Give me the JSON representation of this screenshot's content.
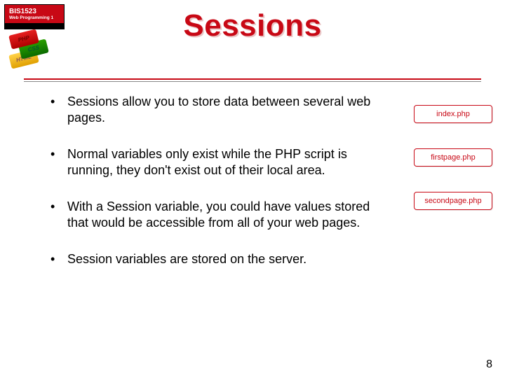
{
  "logo": {
    "course_code": "BIS1523",
    "course_name": "Web Programming 1",
    "bricks": [
      "PHP",
      "CSS",
      "HTML"
    ]
  },
  "title": "Sessions",
  "bullets": [
    "Sessions allow you to store data between several web pages.",
    "Normal variables only exist while the PHP script is running, they don't exist out of their local area.",
    "With a Session variable, you could have values stored that would be accessible from all of your web pages.",
    "Session variables are stored on the server."
  ],
  "files": [
    "index.php",
    "firstpage.php",
    "secondpage.php"
  ],
  "page_number": "8"
}
